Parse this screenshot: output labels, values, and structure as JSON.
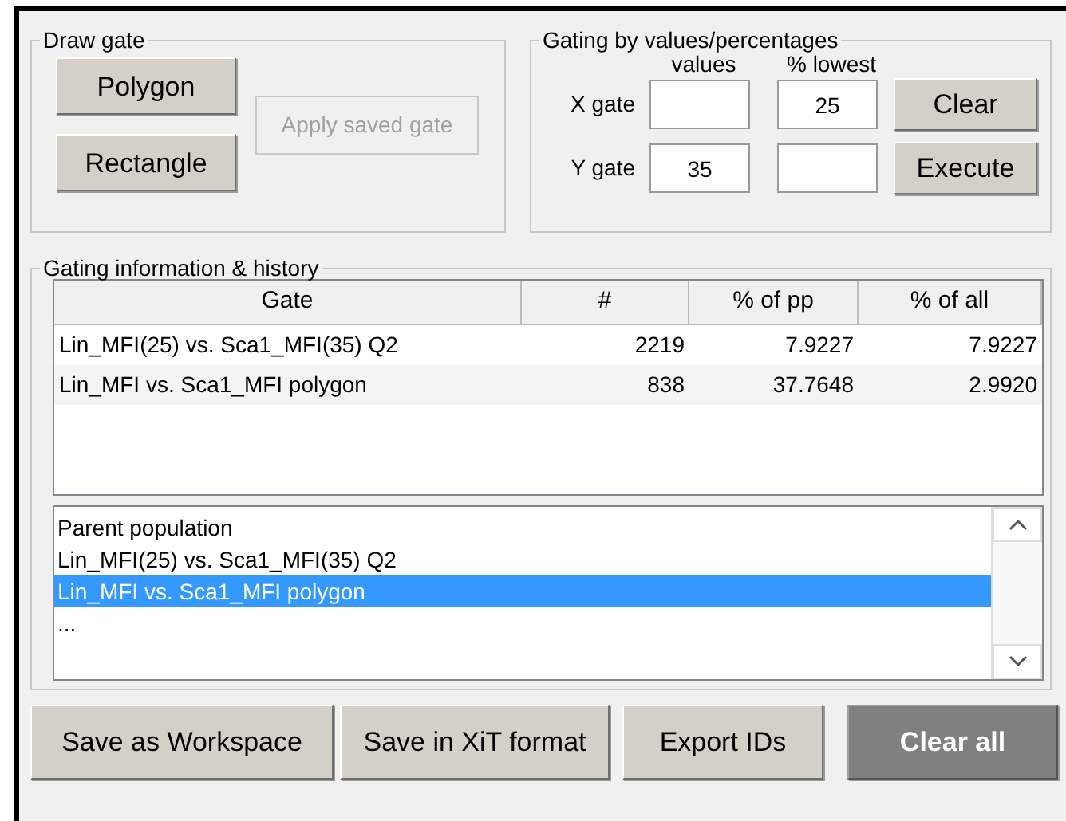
{
  "draw_gate": {
    "title": "Draw gate",
    "buttons": [
      {
        "label": "Polygon",
        "disabled": false
      },
      {
        "label": "Rectangle",
        "disabled": false
      },
      {
        "label": "Apply saved gate",
        "disabled": true
      }
    ]
  },
  "gating_by_values": {
    "title": "Gating by values/percentages",
    "column_headers": [
      "values",
      "% lowest"
    ],
    "rows": [
      {
        "label": "X gate",
        "percent": "25"
      },
      {
        "label": "Y gate",
        "value": "35"
      }
    ],
    "buttons": [
      "Clear",
      "Execute"
    ]
  },
  "gating_info": {
    "title": "Gating information & history",
    "table": {
      "columns": [
        "Gate",
        "#",
        "% of pp",
        "% of all"
      ],
      "rows": [
        [
          "Lin_MFI(25) vs. Sca1_MFI(35) Q2",
          "2219",
          "7.9227",
          "7.9227"
        ],
        [
          "Lin_MFI vs. Sca1_MFI polygon",
          "838",
          "37.7648",
          "2.9920"
        ]
      ]
    },
    "history": [
      {
        "label": "Parent population",
        "selected": false
      },
      {
        "label": "Lin_MFI(25) vs. Sca1_MFI(35) Q2",
        "selected": false
      },
      {
        "label": "Lin_MFI vs. Sca1_MFI polygon",
        "selected": true
      },
      {
        "label": "...",
        "selected": false
      }
    ]
  },
  "actions": [
    {
      "label": "Save as Workspace",
      "kind": "normal"
    },
    {
      "label": "Save in XiT format",
      "kind": "normal"
    },
    {
      "label": "Export IDs",
      "kind": "normal"
    },
    {
      "label": "Clear all",
      "kind": "dark"
    }
  ]
}
